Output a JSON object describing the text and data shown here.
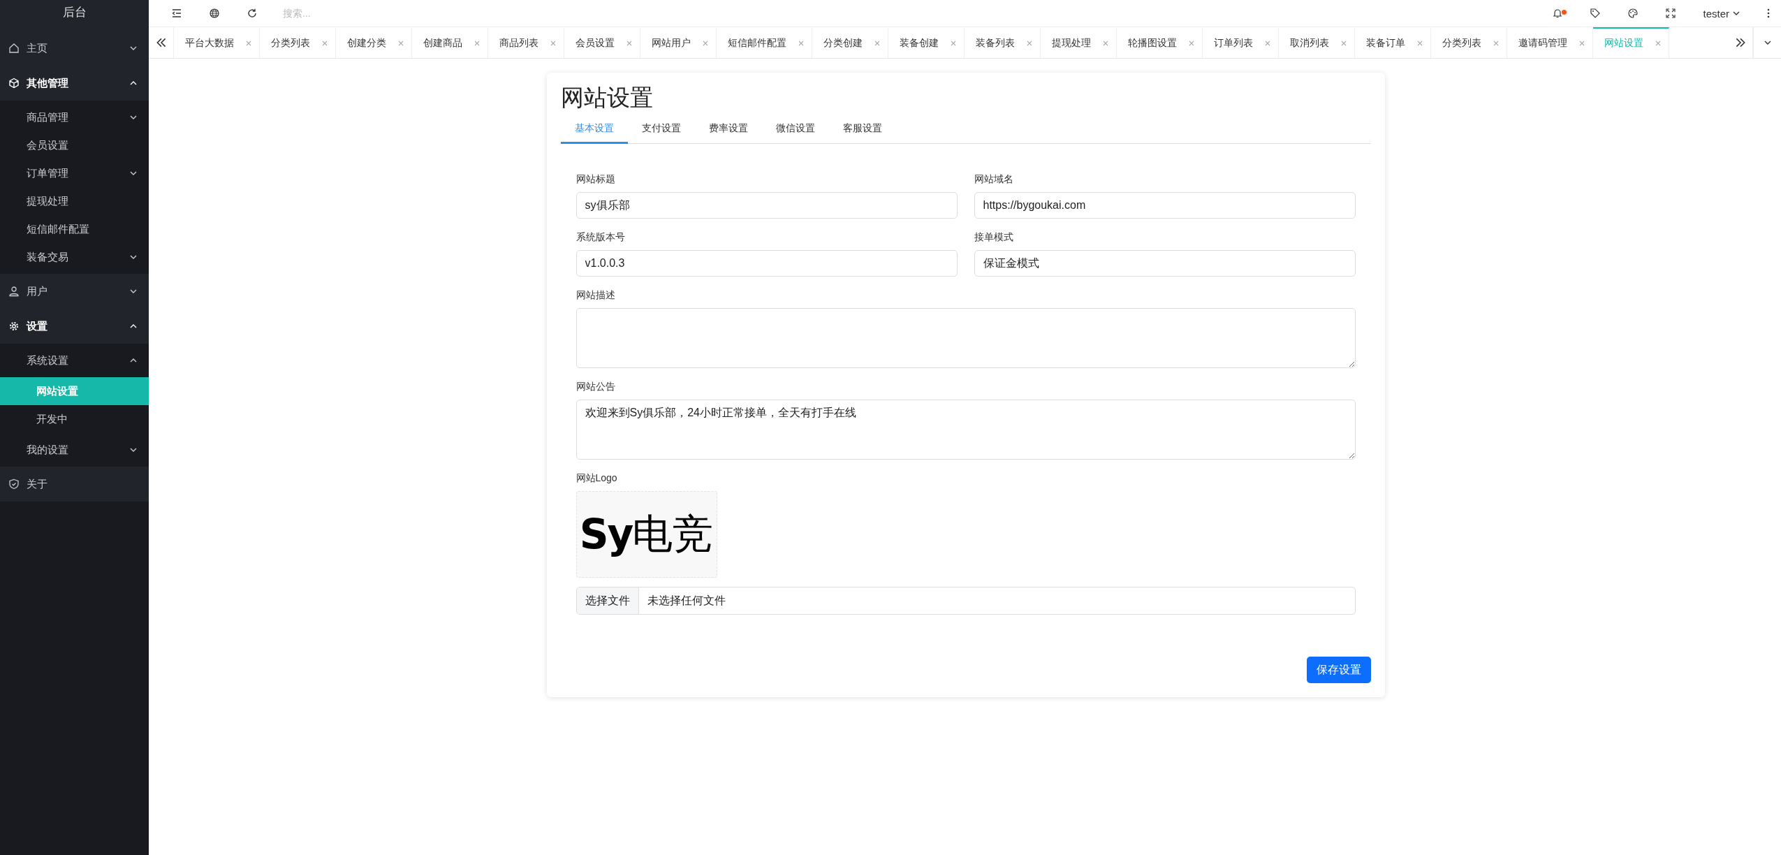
{
  "sidebar": {
    "title": "后台",
    "items": [
      {
        "label": "主页",
        "kind": "group",
        "expanded": false,
        "selected": false
      },
      {
        "label": "其他管理",
        "kind": "group",
        "expanded": true,
        "selected": false,
        "children": [
          {
            "label": "商品管理",
            "kind": "group",
            "expanded": false,
            "selected": false
          },
          {
            "label": "会员设置",
            "kind": "link",
            "selected": false
          },
          {
            "label": "订单管理",
            "kind": "group",
            "expanded": false,
            "selected": false
          },
          {
            "label": "提现处理",
            "kind": "link",
            "selected": false
          },
          {
            "label": "短信邮件配置",
            "kind": "link",
            "selected": false
          },
          {
            "label": "装备交易",
            "kind": "group",
            "expanded": false,
            "selected": false
          }
        ]
      },
      {
        "label": "用户",
        "kind": "group",
        "expanded": false,
        "selected": false
      },
      {
        "label": "设置",
        "kind": "group",
        "expanded": true,
        "selected": false,
        "children": [
          {
            "label": "系统设置",
            "kind": "group",
            "expanded": true,
            "selected": false,
            "children": [
              {
                "label": "网站设置",
                "kind": "link",
                "selected": true
              },
              {
                "label": "开发中",
                "kind": "link",
                "selected": false
              }
            ]
          },
          {
            "label": "我的设置",
            "kind": "group",
            "expanded": false,
            "selected": false
          }
        ]
      },
      {
        "label": "关于",
        "kind": "link",
        "selected": false
      }
    ]
  },
  "toolbar": {
    "search": {
      "placeholder": "搜索..."
    },
    "notification_dot": true,
    "user": "tester"
  },
  "page_tabs": [
    {
      "label": "平台大数据",
      "selected": false
    },
    {
      "label": "分类列表",
      "selected": false
    },
    {
      "label": "创建分类",
      "selected": false
    },
    {
      "label": "创建商品",
      "selected": false
    },
    {
      "label": "商品列表",
      "selected": false
    },
    {
      "label": "会员设置",
      "selected": false
    },
    {
      "label": "网站用户",
      "selected": false
    },
    {
      "label": "短信邮件配置",
      "selected": false
    },
    {
      "label": "分类创建",
      "selected": false
    },
    {
      "label": "装备创建",
      "selected": false
    },
    {
      "label": "装备列表",
      "selected": false
    },
    {
      "label": "提现处理",
      "selected": false
    },
    {
      "label": "轮播图设置",
      "selected": false
    },
    {
      "label": "订单列表",
      "selected": false
    },
    {
      "label": "取消列表",
      "selected": false
    },
    {
      "label": "装备订单",
      "selected": false
    },
    {
      "label": "分类列表",
      "selected": false
    },
    {
      "label": "邀请码管理",
      "selected": false
    },
    {
      "label": "网站设置",
      "selected": true
    }
  ],
  "card": {
    "title": "网站设置",
    "tabs": [
      {
        "label": "基本设置",
        "selected": true
      },
      {
        "label": "支付设置",
        "selected": false
      },
      {
        "label": "费率设置",
        "selected": false
      },
      {
        "label": "微信设置",
        "selected": false
      },
      {
        "label": "客服设置",
        "selected": false
      }
    ],
    "fields": [
      {
        "label": "网站标题",
        "kind": "input",
        "value": "sy俱乐部"
      },
      {
        "label": "网站域名",
        "kind": "input",
        "value": "https://bygoukai.com"
      },
      {
        "label": "系统版本号",
        "kind": "input",
        "value": "v1.0.0.3"
      },
      {
        "label": "接单模式",
        "kind": "input",
        "value": "保证金模式"
      },
      {
        "label": "网站描述",
        "kind": "textarea"
      },
      {
        "label": "网站公告",
        "kind": "textarea",
        "value": "欢迎来到Sy俱乐部，24小时正常接单，全天有打手在线"
      }
    ],
    "logo": {
      "label": "网站Logo",
      "image_text_latin": "Sy",
      "image_text_cjk": "电竞",
      "file_button": "选择文件",
      "file_status": "未选择任何文件"
    },
    "save_button": "保存设置"
  }
}
